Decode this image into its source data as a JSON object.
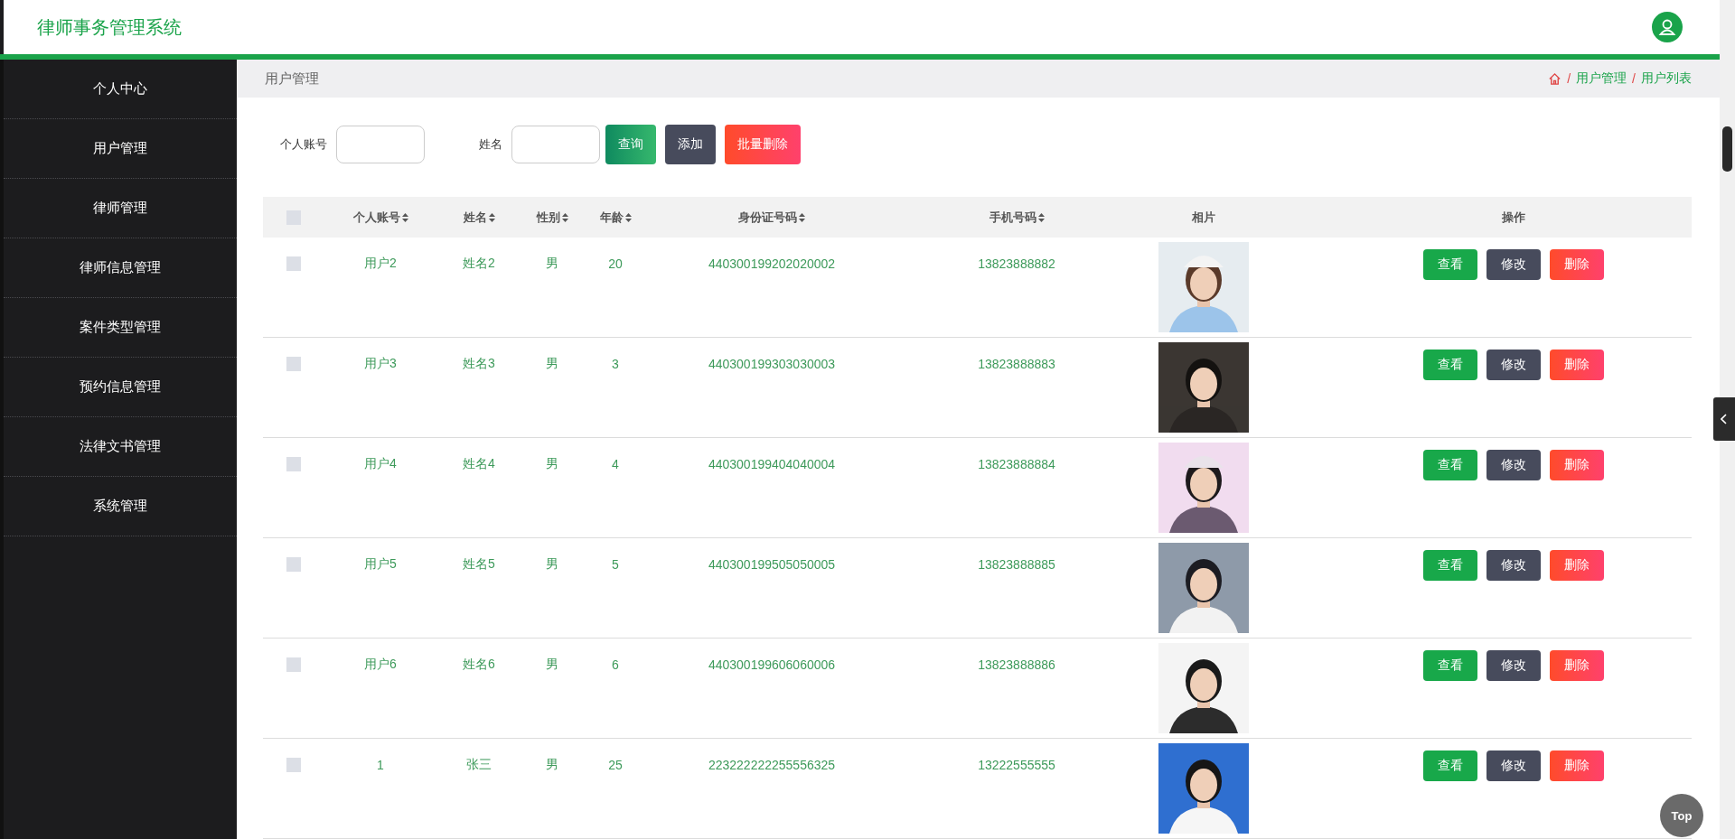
{
  "header": {
    "title": "律师事务管理系统"
  },
  "sidebar": {
    "items": [
      {
        "label": "个人中心"
      },
      {
        "label": "用户管理"
      },
      {
        "label": "律师管理"
      },
      {
        "label": "律师信息管理"
      },
      {
        "label": "案件类型管理"
      },
      {
        "label": "预约信息管理"
      },
      {
        "label": "法律文书管理"
      },
      {
        "label": "系统管理"
      }
    ]
  },
  "page_title": "用户管理",
  "breadcrumb": {
    "separator": "/",
    "items": [
      "用户管理",
      "用户列表"
    ]
  },
  "search": {
    "fields": [
      {
        "label": "个人账号"
      },
      {
        "label": "姓名"
      }
    ],
    "buttons": [
      {
        "label": "查询",
        "kind": "search"
      },
      {
        "label": "添加",
        "kind": "add"
      },
      {
        "label": "批量删除",
        "kind": "delete"
      }
    ]
  },
  "table": {
    "header_checked": false,
    "columns": [
      {
        "label": "个人账号",
        "sortable": true
      },
      {
        "label": "姓名",
        "sortable": true
      },
      {
        "label": "性别",
        "sortable": true
      },
      {
        "label": "年龄",
        "sortable": true
      },
      {
        "label": "身份证号码",
        "sortable": true
      },
      {
        "label": "手机号码",
        "sortable": true
      },
      {
        "label": "相片",
        "sortable": false
      },
      {
        "label": "操作",
        "sortable": false
      }
    ],
    "rows": [
      {
        "checked": false,
        "account": "用户2",
        "name": "姓名2",
        "gender": "男",
        "age": "20",
        "id_number": "440300199202020002",
        "phone": "13823888882",
        "actions": [
          {
            "label": "查看",
            "kind": "view"
          },
          {
            "label": "修改",
            "kind": "edit"
          },
          {
            "label": "删除",
            "kind": "delete"
          }
        ]
      },
      {
        "checked": false,
        "account": "用户3",
        "name": "姓名3",
        "gender": "男",
        "age": "3",
        "id_number": "440300199303030003",
        "phone": "13823888883",
        "actions": [
          {
            "label": "查看",
            "kind": "view"
          },
          {
            "label": "修改",
            "kind": "edit"
          },
          {
            "label": "删除",
            "kind": "delete"
          }
        ]
      },
      {
        "checked": false,
        "account": "用户4",
        "name": "姓名4",
        "gender": "男",
        "age": "4",
        "id_number": "440300199404040004",
        "phone": "13823888884",
        "actions": [
          {
            "label": "查看",
            "kind": "view"
          },
          {
            "label": "修改",
            "kind": "edit"
          },
          {
            "label": "删除",
            "kind": "delete"
          }
        ]
      },
      {
        "checked": false,
        "account": "用户5",
        "name": "姓名5",
        "gender": "男",
        "age": "5",
        "id_number": "440300199505050005",
        "phone": "13823888885",
        "actions": [
          {
            "label": "查看",
            "kind": "view"
          },
          {
            "label": "修改",
            "kind": "edit"
          },
          {
            "label": "删除",
            "kind": "delete"
          }
        ]
      },
      {
        "checked": false,
        "account": "用户6",
        "name": "姓名6",
        "gender": "男",
        "age": "6",
        "id_number": "440300199606060006",
        "phone": "13823888886",
        "actions": [
          {
            "label": "查看",
            "kind": "view"
          },
          {
            "label": "修改",
            "kind": "edit"
          },
          {
            "label": "删除",
            "kind": "delete"
          }
        ]
      },
      {
        "checked": false,
        "account": "1",
        "name": "张三",
        "gender": "男",
        "age": "25",
        "id_number": "223222222255556325",
        "phone": "13222555555",
        "actions": [
          {
            "label": "查看",
            "kind": "view"
          },
          {
            "label": "修改",
            "kind": "edit"
          },
          {
            "label": "删除",
            "kind": "delete"
          }
        ]
      }
    ]
  },
  "back_to_top": {
    "label": "Top"
  }
}
